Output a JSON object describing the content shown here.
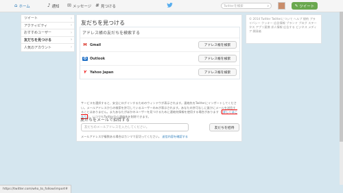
{
  "topbar": {
    "home": "ホーム",
    "notifications": "通知",
    "messages": "メッセージ",
    "discover": "見つける",
    "search_placeholder": "Twitterを検索",
    "tweet_button": "ツイート"
  },
  "sidebar": {
    "items": [
      {
        "label": "ツイート"
      },
      {
        "label": "アクティビティ"
      },
      {
        "label": "おすすめユーザー"
      },
      {
        "label": "友だちを見つける"
      },
      {
        "label": "人気のアカウント"
      }
    ]
  },
  "main": {
    "title": "友だちを見つける",
    "address_section": "アドレス帳の友だちを検索する",
    "providers": [
      {
        "name": "Gmail",
        "button": "アドレス帳を検索"
      },
      {
        "name": "Outlook",
        "button": "アドレス帳を検索"
      },
      {
        "name": "Yahoo Japan",
        "button": "アドレス帳を検索"
      }
    ],
    "disclaimer_pre": "サービスを選択すると、安全にログインするためのウィンドウが表示されます。連絡先をTwitterにインポートしてください。メールアドレスからの検索を許可しているユーザーのみが表示されます。あなたの許可なしに誰かにメールを送信することはありません。またあなたがほかのユーザーを見つけるために連絡先情報を使用する場合があります（",
    "disclaimer_link": "詳しくはこちら",
    "disclaimer_post": "）。いつでもTwitterから連絡先を削除できます。",
    "invite_title": "友だちをメールで招待する",
    "email_placeholder": "友だちのメールアドレスを入力してください。",
    "invite_button": "友だちを招待",
    "footer_note": "メールアドレスが複数ある場合はカンマで区切ってください。",
    "footer_link": "送信内容を確認する"
  },
  "right": {
    "footer_text": "© 2014 Twitter  Twitterについて  ヘルプ  規約  プライバシー  クッキー  広告情報  ブランド  ブログ  ステータス  アプリ連携  求人情報  広告する  ビジネス  メディア  開発者"
  },
  "statusbar": {
    "url": "https://twitter.com/who_to_follow/import#"
  },
  "colors": {
    "accent": "#2b7bb9",
    "tweet_green": "#6aa84f",
    "background": "#d5e6ef",
    "highlight_red": "#e00000"
  }
}
